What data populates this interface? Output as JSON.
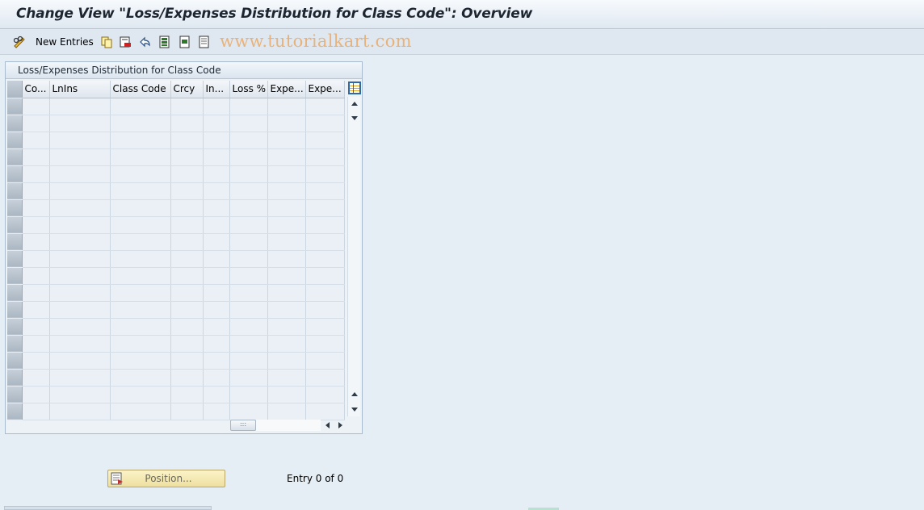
{
  "window": {
    "title": "Change View \"Loss/Expenses Distribution for Class Code\": Overview"
  },
  "toolbar": {
    "new_entries_label": "New Entries",
    "icons": [
      "edit-glasses-icon",
      "copy-icon",
      "delete-icon",
      "undo-icon",
      "select-all-icon",
      "select-block-icon",
      "deselect-all-icon"
    ]
  },
  "watermark": "www.tutorialkart.com",
  "table": {
    "title": "Loss/Expenses Distribution for Class Code",
    "columns": [
      "Co...",
      "LnIns",
      "Class Code",
      "Crcy",
      "In...",
      "Loss %",
      "Expe...",
      "Expe..."
    ],
    "visible_rows": 19,
    "rows": []
  },
  "footer": {
    "position_button": "Position...",
    "entry_text": "Entry 0 of 0"
  }
}
